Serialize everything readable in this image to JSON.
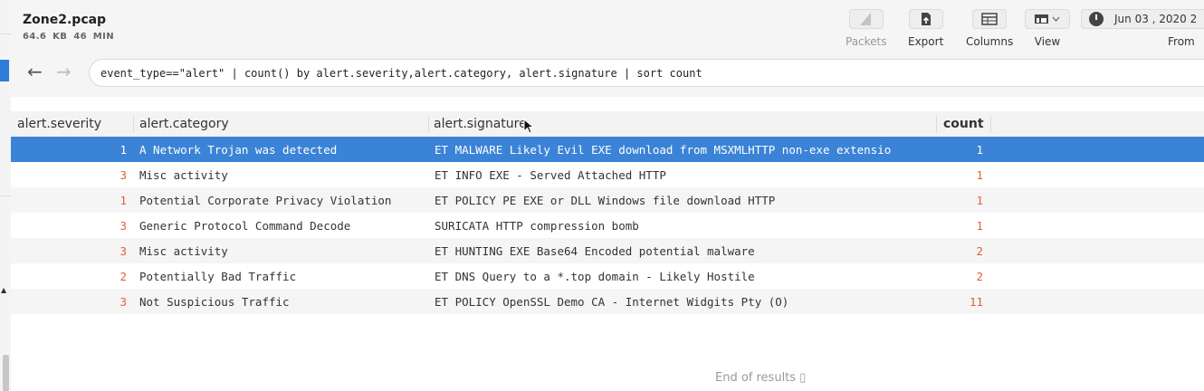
{
  "file": {
    "name": "Zone2.pcap",
    "meta": "64.6 KB 46 MIN"
  },
  "toolbar": {
    "packets": "Packets",
    "export": "Export",
    "columns": "Columns",
    "view": "View",
    "from": "From",
    "date": "Jun 03 , 2020 2"
  },
  "nav": {
    "back": "←",
    "forward": "→"
  },
  "query": "event_type==\"alert\" | count() by alert.severity,alert.category, alert.signature | sort count",
  "columns": [
    "alert.severity",
    "alert.category",
    "alert.signature",
    "count"
  ],
  "rows": [
    {
      "severity": "1",
      "category": "A Network Trojan was detected",
      "signature": "ET MALWARE Likely Evil EXE download from MSXMLHTTP non-exe extensio",
      "count": "1"
    },
    {
      "severity": "3",
      "category": "Misc activity",
      "signature": "ET INFO EXE - Served Attached HTTP",
      "count": "1"
    },
    {
      "severity": "1",
      "category": "Potential Corporate Privacy Violation",
      "signature": "ET POLICY PE EXE or DLL Windows file download HTTP",
      "count": "1"
    },
    {
      "severity": "3",
      "category": "Generic Protocol Command Decode",
      "signature": "SURICATA HTTP compression bomb",
      "count": "1"
    },
    {
      "severity": "3",
      "category": "Misc activity",
      "signature": "ET HUNTING EXE Base64 Encoded potential malware",
      "count": "2"
    },
    {
      "severity": "2",
      "category": "Potentially Bad Traffic",
      "signature": "ET DNS Query to a *.top domain - Likely Hostile",
      "count": "2"
    },
    {
      "severity": "3",
      "category": "Not Suspicious Traffic",
      "signature": "ET POLICY OpenSSL Demo CA - Internet Widgits Pty (O)",
      "count": "11"
    }
  ],
  "footer": {
    "end": "End of results ▯"
  },
  "colors": {
    "selected_row": "#3b83d6",
    "number": "#e0603a",
    "accent": "#2e7bd8"
  }
}
